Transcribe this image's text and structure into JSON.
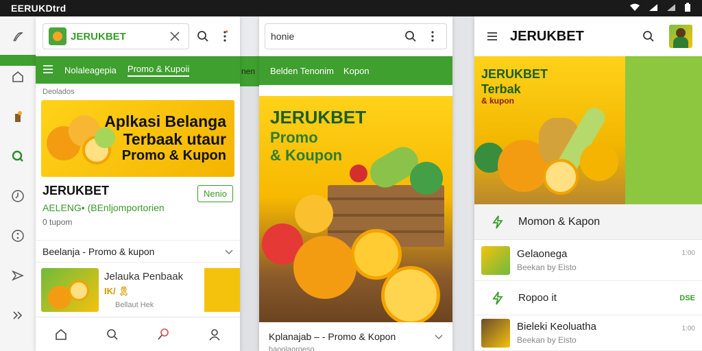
{
  "status_bar": {
    "app_name": "EERUKDtrd",
    "wifi_icon": "wifi-icon",
    "signal_icon": "signal-icon",
    "battery_icon": "battery-icon"
  },
  "left_rail": {
    "icons": [
      "pen-icon",
      "home-icon",
      "trash-icon",
      "search-app-icon",
      "clock-icon",
      "more-circle-icon",
      "send-icon",
      "double-chevron-icon"
    ]
  },
  "gap_strip": {
    "text": "nen"
  },
  "panel1": {
    "search_brand": "JERUKBET",
    "nav": {
      "items": [
        "Nolaleagepia",
        "Promo & Kupoii"
      ]
    },
    "breadcrumb": "Deolados",
    "banner": {
      "line1": "Aplkasi Belanga",
      "line2": "Terbaak utaur",
      "line3": "Promo & Kupon"
    },
    "profile": {
      "name": "JERUKBET",
      "subtitle": "AELENG• (BEnljomportorien",
      "count": "0 tupom",
      "menu_button": "Nenio"
    },
    "row_label": "Beelanja - Promo & kupon",
    "card": {
      "title": "Jelauka Penbaak",
      "meta": "IK/ 🎗",
      "sub": "Bellaut Hek"
    }
  },
  "panel2": {
    "search_text": "honie",
    "nav": {
      "items": [
        "Belden Tenonim",
        "Kopon"
      ]
    },
    "banner": {
      "headline": "JERUKBET",
      "sub1": "Promo",
      "sub2": "& Koupon"
    },
    "footer_label": "Kplanajab – - Promo & Kopon",
    "footer_sub": "baoolaoroeso"
  },
  "panel3": {
    "title": "JERUKBET",
    "banner": {
      "h1": "JERUKBET",
      "h2": "Terbak",
      "h3": "& kupon"
    },
    "menu_label": "Momon & Kapon",
    "items": [
      {
        "title": "Gelaonega",
        "sub": "Beekan by Eisto",
        "meta": "1:00"
      },
      {
        "title": "Ropoo it",
        "sub": "",
        "meta": "DSE"
      },
      {
        "title": "Bieleki Keoluatha",
        "sub": "Beekan by Eisto",
        "meta": "1:00"
      }
    ]
  }
}
